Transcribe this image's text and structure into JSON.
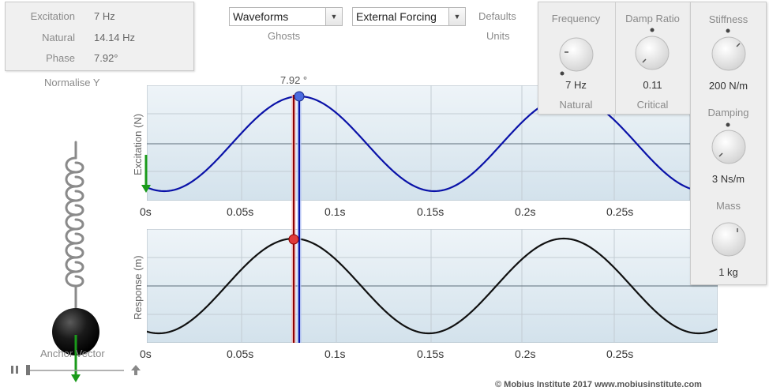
{
  "info": {
    "excitation_label": "Excitation",
    "excitation_value": "7 Hz",
    "natural_label": "Natural",
    "natural_value": "14.14 Hz",
    "phase_label": "Phase",
    "phase_value": "7.92°"
  },
  "normalise_label": "Normalise Y",
  "dropdowns": {
    "waveforms": "Waveforms",
    "forcing": "External Forcing",
    "ghosts_label": "Ghosts",
    "defaults_label": "Defaults",
    "units_label": "Units"
  },
  "knobs": {
    "frequency": {
      "title": "Frequency",
      "value": "7 Hz",
      "sub": "Natural"
    },
    "damp_ratio": {
      "title": "Damp Ratio",
      "value": "0.11",
      "sub": "Critical"
    },
    "stiffness": {
      "title": "Stiffness",
      "value": "200 N/m"
    },
    "damping": {
      "title": "Damping",
      "value": "3 Ns/m"
    },
    "mass": {
      "title": "Mass",
      "value": "1 kg"
    }
  },
  "phase_marker_label": "7.92 °",
  "excitation_plot": {
    "ylabel": "Excitation (N)",
    "xticks": [
      "0s",
      "0.05s",
      "0.1s",
      "0.15s",
      "0.2s",
      "0.25s"
    ]
  },
  "response_plot": {
    "ylabel": "Response (m)",
    "xticks": [
      "0s",
      "0.05s",
      "0.1s",
      "0.15s",
      "0.2s",
      "0.25s"
    ]
  },
  "anchor_label": "Anchor Vector",
  "copyright": "© Mobius Institute 2017  www.mobiusinstitute.com",
  "icons": {
    "pause": "pause-icon",
    "up_arrow": "up-arrow-icon"
  },
  "colors": {
    "excitation": "#0a12a8",
    "response": "#111111",
    "marker_red": "#8b0000",
    "arrow_green": "#1a9a1a"
  }
}
